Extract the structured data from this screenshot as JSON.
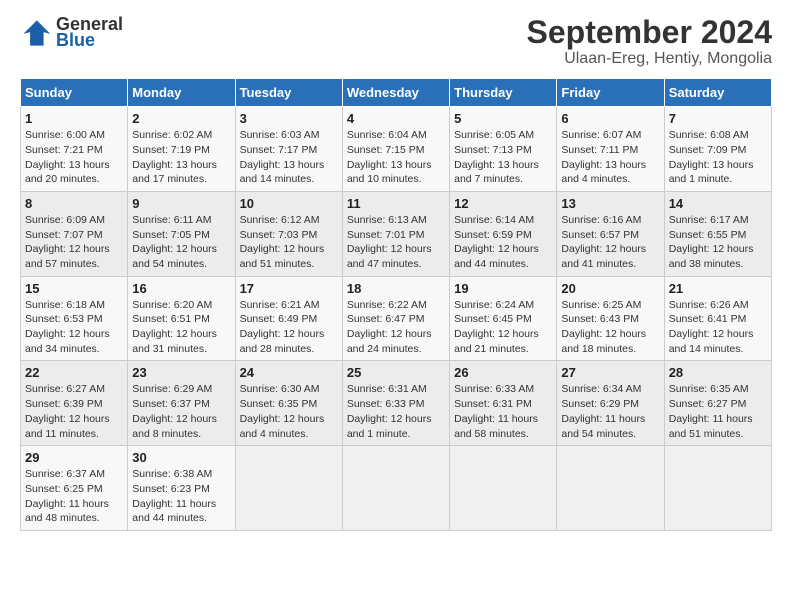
{
  "header": {
    "logo_line1": "General",
    "logo_line2": "Blue",
    "title": "September 2024",
    "subtitle": "Ulaan-Ereg, Hentiy, Mongolia"
  },
  "days_of_week": [
    "Sunday",
    "Monday",
    "Tuesday",
    "Wednesday",
    "Thursday",
    "Friday",
    "Saturday"
  ],
  "weeks": [
    [
      {
        "day": "1",
        "sunrise": "6:00 AM",
        "sunset": "7:21 PM",
        "daylight": "13 hours and 20 minutes."
      },
      {
        "day": "2",
        "sunrise": "6:02 AM",
        "sunset": "7:19 PM",
        "daylight": "13 hours and 17 minutes."
      },
      {
        "day": "3",
        "sunrise": "6:03 AM",
        "sunset": "7:17 PM",
        "daylight": "13 hours and 14 minutes."
      },
      {
        "day": "4",
        "sunrise": "6:04 AM",
        "sunset": "7:15 PM",
        "daylight": "13 hours and 10 minutes."
      },
      {
        "day": "5",
        "sunrise": "6:05 AM",
        "sunset": "7:13 PM",
        "daylight": "13 hours and 7 minutes."
      },
      {
        "day": "6",
        "sunrise": "6:07 AM",
        "sunset": "7:11 PM",
        "daylight": "13 hours and 4 minutes."
      },
      {
        "day": "7",
        "sunrise": "6:08 AM",
        "sunset": "7:09 PM",
        "daylight": "13 hours and 1 minute."
      }
    ],
    [
      {
        "day": "8",
        "sunrise": "6:09 AM",
        "sunset": "7:07 PM",
        "daylight": "12 hours and 57 minutes."
      },
      {
        "day": "9",
        "sunrise": "6:11 AM",
        "sunset": "7:05 PM",
        "daylight": "12 hours and 54 minutes."
      },
      {
        "day": "10",
        "sunrise": "6:12 AM",
        "sunset": "7:03 PM",
        "daylight": "12 hours and 51 minutes."
      },
      {
        "day": "11",
        "sunrise": "6:13 AM",
        "sunset": "7:01 PM",
        "daylight": "12 hours and 47 minutes."
      },
      {
        "day": "12",
        "sunrise": "6:14 AM",
        "sunset": "6:59 PM",
        "daylight": "12 hours and 44 minutes."
      },
      {
        "day": "13",
        "sunrise": "6:16 AM",
        "sunset": "6:57 PM",
        "daylight": "12 hours and 41 minutes."
      },
      {
        "day": "14",
        "sunrise": "6:17 AM",
        "sunset": "6:55 PM",
        "daylight": "12 hours and 38 minutes."
      }
    ],
    [
      {
        "day": "15",
        "sunrise": "6:18 AM",
        "sunset": "6:53 PM",
        "daylight": "12 hours and 34 minutes."
      },
      {
        "day": "16",
        "sunrise": "6:20 AM",
        "sunset": "6:51 PM",
        "daylight": "12 hours and 31 minutes."
      },
      {
        "day": "17",
        "sunrise": "6:21 AM",
        "sunset": "6:49 PM",
        "daylight": "12 hours and 28 minutes."
      },
      {
        "day": "18",
        "sunrise": "6:22 AM",
        "sunset": "6:47 PM",
        "daylight": "12 hours and 24 minutes."
      },
      {
        "day": "19",
        "sunrise": "6:24 AM",
        "sunset": "6:45 PM",
        "daylight": "12 hours and 21 minutes."
      },
      {
        "day": "20",
        "sunrise": "6:25 AM",
        "sunset": "6:43 PM",
        "daylight": "12 hours and 18 minutes."
      },
      {
        "day": "21",
        "sunrise": "6:26 AM",
        "sunset": "6:41 PM",
        "daylight": "12 hours and 14 minutes."
      }
    ],
    [
      {
        "day": "22",
        "sunrise": "6:27 AM",
        "sunset": "6:39 PM",
        "daylight": "12 hours and 11 minutes."
      },
      {
        "day": "23",
        "sunrise": "6:29 AM",
        "sunset": "6:37 PM",
        "daylight": "12 hours and 8 minutes."
      },
      {
        "day": "24",
        "sunrise": "6:30 AM",
        "sunset": "6:35 PM",
        "daylight": "12 hours and 4 minutes."
      },
      {
        "day": "25",
        "sunrise": "6:31 AM",
        "sunset": "6:33 PM",
        "daylight": "12 hours and 1 minute."
      },
      {
        "day": "26",
        "sunrise": "6:33 AM",
        "sunset": "6:31 PM",
        "daylight": "11 hours and 58 minutes."
      },
      {
        "day": "27",
        "sunrise": "6:34 AM",
        "sunset": "6:29 PM",
        "daylight": "11 hours and 54 minutes."
      },
      {
        "day": "28",
        "sunrise": "6:35 AM",
        "sunset": "6:27 PM",
        "daylight": "11 hours and 51 minutes."
      }
    ],
    [
      {
        "day": "29",
        "sunrise": "6:37 AM",
        "sunset": "6:25 PM",
        "daylight": "11 hours and 48 minutes."
      },
      {
        "day": "30",
        "sunrise": "6:38 AM",
        "sunset": "6:23 PM",
        "daylight": "11 hours and 44 minutes."
      },
      null,
      null,
      null,
      null,
      null
    ]
  ]
}
